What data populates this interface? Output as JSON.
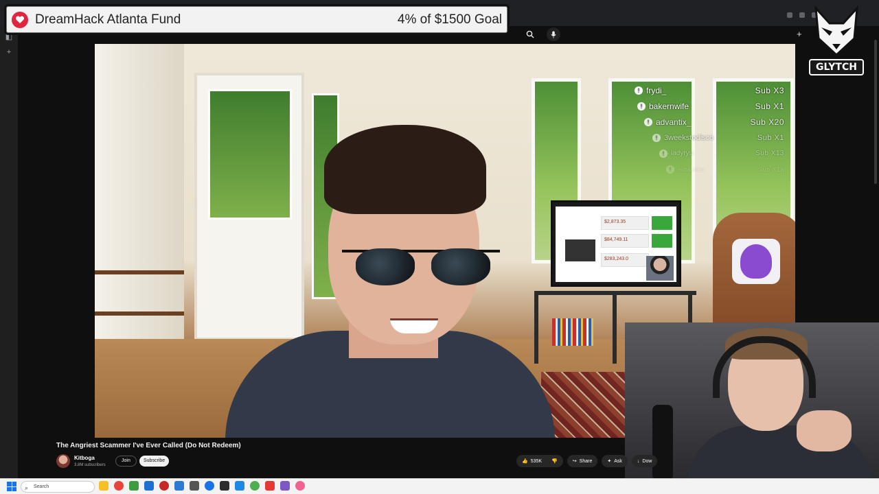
{
  "fund": {
    "title": "DreamHack Atlanta Fund",
    "goal": "4% of $1500 Goal"
  },
  "logo": {
    "label": "GLYTCH"
  },
  "subs": [
    {
      "name": "frydi_",
      "amount": "Sub X3"
    },
    {
      "name": "bakernwife",
      "amount": "Sub X1"
    },
    {
      "name": "advantix_",
      "amount": "Sub X20"
    },
    {
      "name": "3weekstodisco",
      "amount": "Sub X1"
    },
    {
      "name": "ladyryu",
      "amount": "Sub X13"
    },
    {
      "name": "elibasnao",
      "amount": "Sub X1a"
    }
  ],
  "tv_screen": {
    "rows": [
      "$2,873.35",
      "$84,749.11",
      "$283,243.0"
    ]
  },
  "video": {
    "title": "The Angriest Scammer I've Ever Called (Do Not Redeem)",
    "channel": "Kitboga",
    "subscribers": "3.8M subscribers",
    "join_label": "Join",
    "subscribe_label": "Subscribe",
    "likes": "535K",
    "share_label": "Share",
    "ask_label": "Ask",
    "download_label": "Dow"
  },
  "taskbar": {
    "search_placeholder": "Search",
    "icon_colors": [
      "#f6c026",
      "#e8443a",
      "#3f9b3f",
      "#1d6fd1",
      "#c62828",
      "#2b7bd4",
      "#555555",
      "#1a73e8",
      "#2c2c2c",
      "#1e88e5",
      "#4caf50",
      "#e53935",
      "#7e57c2",
      "#f06292"
    ]
  },
  "colors": {
    "fund_icon": "#e0263f",
    "yt_bg": "#0f0f0f"
  }
}
